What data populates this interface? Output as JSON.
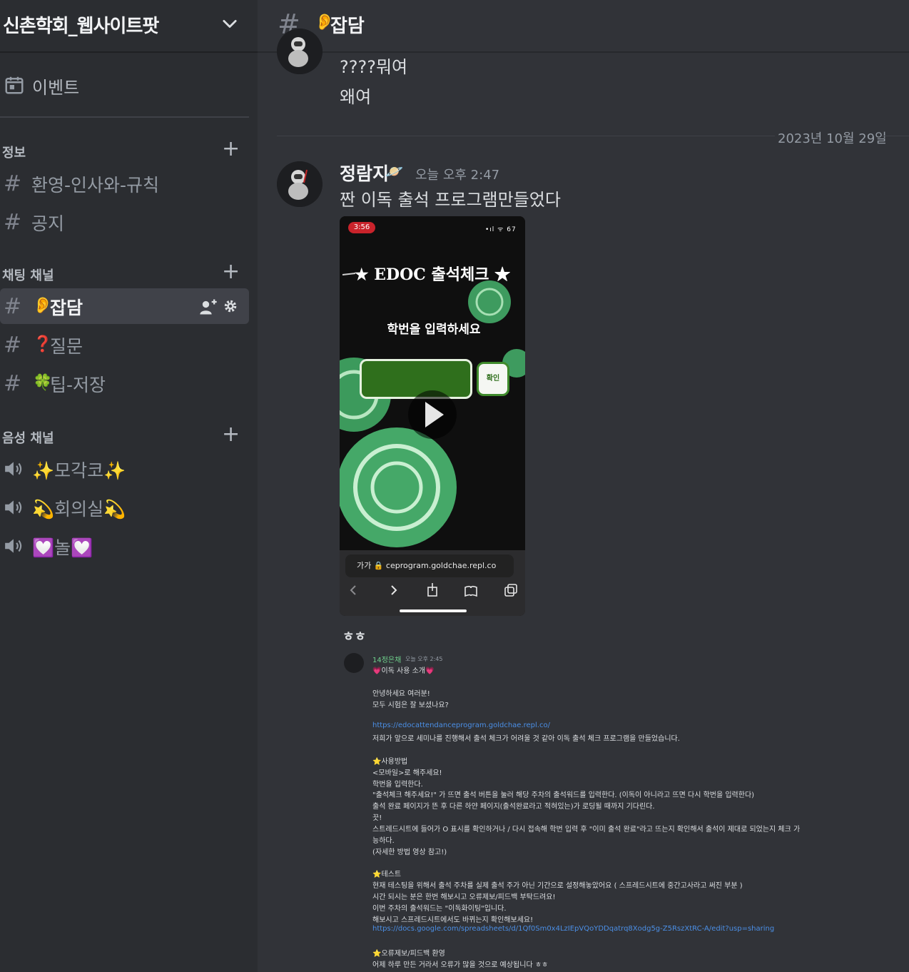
{
  "server": {
    "name": "신촌학회_웹사이트팟"
  },
  "sidebar": {
    "events_label": "이벤트",
    "categories": [
      {
        "label": "정보",
        "plus": "+"
      },
      {
        "label": "채팅 채널",
        "plus": "+"
      },
      {
        "label": "음성 채널",
        "plus": "+"
      }
    ],
    "channels": [
      {
        "hash": "#",
        "emoji": "",
        "name": "환영-인사와-규칙"
      },
      {
        "hash": "#",
        "emoji": "",
        "name": "공지"
      },
      {
        "hash": "#",
        "emoji": "👂",
        "name": "잡담"
      },
      {
        "hash": "#",
        "emoji": "❓",
        "name": "질문"
      },
      {
        "hash": "#",
        "emoji": "🍀",
        "name": "팁-저장"
      }
    ],
    "voice_channels": [
      {
        "name": "✨모각코✨"
      },
      {
        "name": "💫회의실💫"
      },
      {
        "name": "💟놀💟"
      }
    ]
  },
  "header": {
    "hash": "#",
    "emoji": "👂",
    "title": "잡담"
  },
  "messages": {
    "prev_lines": [
      "????뭐여",
      "왜여"
    ],
    "date_divider": "2023년 10월 29일",
    "author": "정람지",
    "author_emoji": "🪐",
    "timestamp": "오늘 오후 2:47",
    "text": "짠 이독 출석 프로그램만들었다",
    "caption": "ㅎㅎ"
  },
  "phone": {
    "clock": "3:56",
    "signal": "•ıl ᯤ 67",
    "heading": "★ EDOC 출석체크 ★",
    "prompt": "학번을 입력하세요",
    "ok_button": "확인",
    "url_text": "가가   🔒 ceprogram.goldchae.repl.co"
  },
  "embedded": {
    "name": "14정은채",
    "time": "오늘 오후 2:45",
    "lines": [
      "💗이독 사용 소개💗",
      "안녕하세요 여러분!",
      "모두 시험은 잘 보셨나요?",
      "https://edocattendanceprogram.goldchae.repl.co/",
      "저희가 앞으로 세미나를 진행해서 출석 체크가 어려울 것 같아 이독 출석 체크 프로그램을 만들었습니다.",
      "⭐사용방법",
      "<모바일>로 해주세요!",
      "학번을 입력한다.",
      "\"출석체크 해주세요!\" 가 뜨면 출석 버튼을 눌러 해당 주차의 출석워드를 입력한다. (이독이 아니라고 뜨면 다시 학번을 입력한다)",
      "출석 완료 페이지가 뜬 후 다른 하얀 페이지(출석완료라고 적혀있는)가 로딩될 때까지 기다린다.",
      "끗!",
      "스트레드시트에 들어가 O 표시를 확인하거나 / 다시 접속해 학번 입력 후 \"이미 출석 완료\"라고 뜨는지 확인해서 출석이 제대로 되었는지 체크 가",
      "능하다.",
      "(자세한 방법 영상 참고!)",
      "⭐테스트",
      "현재 테스팅을 위해서 출석 주차를 실제 출석 주가 아닌 기간으로 설정해놓았어요 ( 스프레드시트에 중간고사라고 써진 부분 )",
      "시간 되시는 분은 한번 해보시고 오류제보/피드백 부탁드려요!",
      "이번 주차의 출석워드는 \"이독화이팅\"입니다.",
      "해보시고 스프레드시트에서도 바뀌는지 확인해보세요!",
      "https://docs.google.com/spreadsheets/d/1Qf0Sm0x4LzIEpVQoYDDqatrq8Xodg5g-Z5RszXtRC-A/edit?usp=sharing",
      "⭐오류제보/피드백 환영",
      "어제 하루 만든 거라서 오류가 많을 것으로 예상됩니다 ㅎㅎ"
    ]
  },
  "colors": {
    "bg": "#313338",
    "sidebar": "#2b2d31",
    "active": "#404249",
    "link": "#4b8fe6",
    "accent_green": "#6fd08c"
  }
}
